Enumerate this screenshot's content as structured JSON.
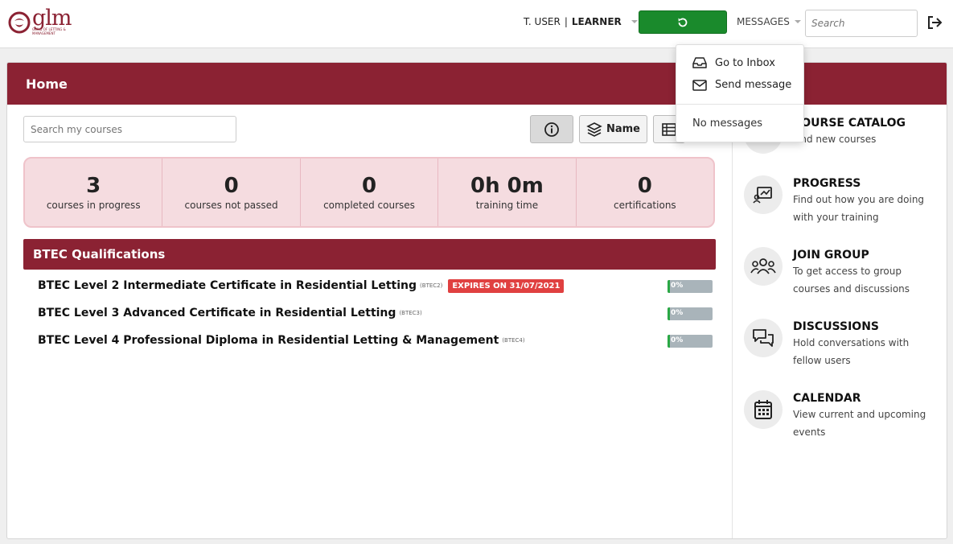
{
  "brand": {
    "logo_word": "glm",
    "logo_tagline": "Guild of Letting & Management",
    "brand_color": "#8b2233"
  },
  "topbar": {
    "user_name": "T. USER",
    "separator": "|",
    "user_role": "LEARNER",
    "sync_icon": "refresh-icon",
    "sync_color": "#1a8a2c",
    "messages_label": "MESSAGES",
    "search_placeholder": "Search",
    "logout_icon": "logout-icon"
  },
  "messages_dropdown": {
    "inbox_label": "Go to Inbox",
    "send_label": "Send message",
    "empty_label": "No messages"
  },
  "page": {
    "title": "Home",
    "course_search_placeholder": "Search my courses",
    "sort_label": "Name"
  },
  "stats": [
    {
      "value": "3",
      "label": "courses in progress"
    },
    {
      "value": "0",
      "label": "courses not passed"
    },
    {
      "value": "0",
      "label": "completed courses"
    },
    {
      "value": "0h 0m",
      "label": "training time"
    },
    {
      "value": "0",
      "label": "certifications"
    }
  ],
  "category": {
    "title": "BTEC Qualifications",
    "courses": [
      {
        "title": "BTEC Level 2 Intermediate Certificate in Residential Letting",
        "code": "(BTEC2)",
        "expiry": "EXPIRES ON 31/07/2021",
        "progress": 0,
        "progress_label": "0%"
      },
      {
        "title": "BTEC Level 3 Advanced Certificate in Residential Letting",
        "code": "(BTEC3)",
        "expiry": "",
        "progress": 0,
        "progress_label": "0%"
      },
      {
        "title": "BTEC Level 4 Professional Diploma in Residential Letting & Management",
        "code": "(BTEC4)",
        "expiry": "",
        "progress": 0,
        "progress_label": "0%"
      }
    ]
  },
  "sidebar": [
    {
      "icon": "catalog-icon",
      "title": "COURSE CATALOG",
      "title_visible": "OURSE CATALOG",
      "desc": "Find new courses"
    },
    {
      "icon": "progress-chart-icon",
      "title": "PROGRESS",
      "desc": "Find out how you are doing with your training"
    },
    {
      "icon": "group-icon",
      "title": "JOIN GROUP",
      "desc": "To get access to group courses and discussions"
    },
    {
      "icon": "discussions-icon",
      "title": "DISCUSSIONS",
      "desc": "Hold conversations with fellow users"
    },
    {
      "icon": "calendar-icon",
      "title": "CALENDAR",
      "desc": "View current and upcoming events"
    }
  ]
}
